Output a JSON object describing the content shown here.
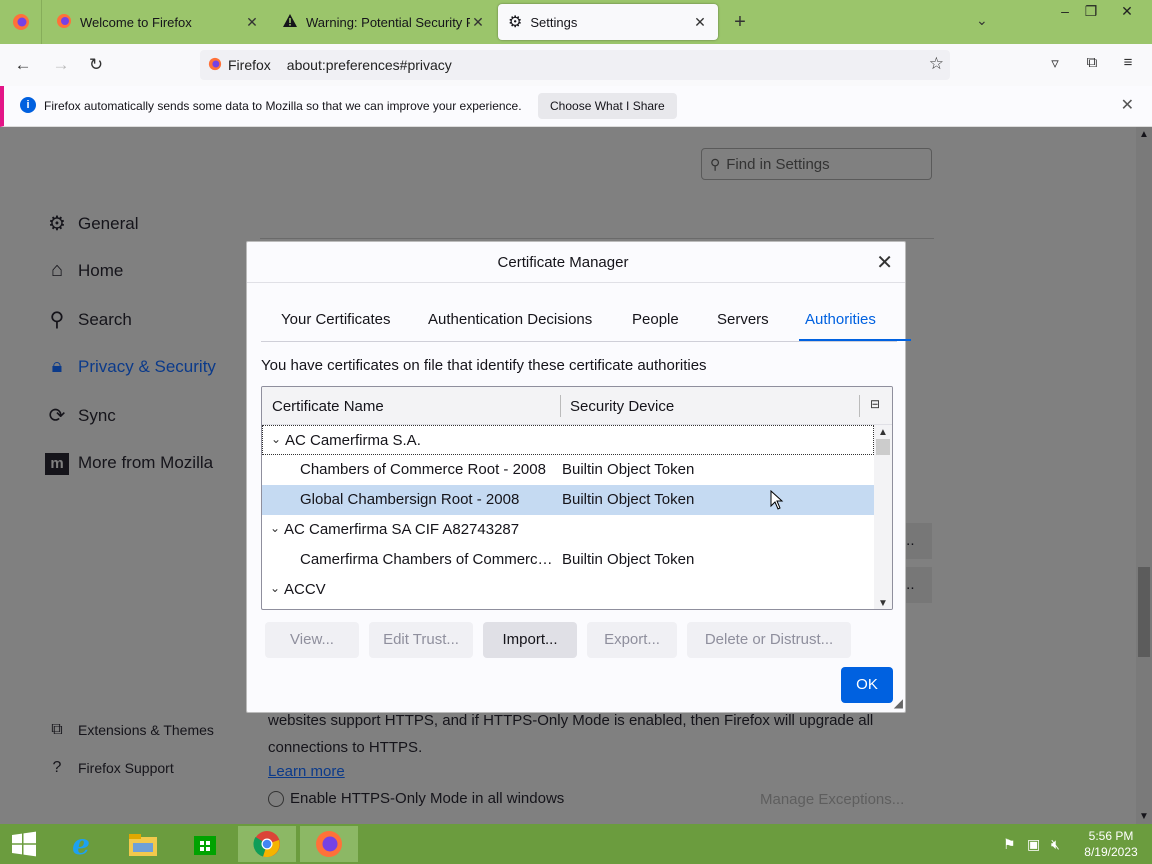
{
  "browser": {
    "tabs": [
      {
        "label": "Welcome to Firefox",
        "icon": "firefox-icon"
      },
      {
        "label": "Warning: Potential Security Risk",
        "icon": "warning-icon"
      },
      {
        "label": "Settings",
        "icon": "gear-icon",
        "active": true
      }
    ],
    "identity_label": "Firefox",
    "url": "about:preferences#privacy"
  },
  "notification": {
    "message": "Firefox automatically sends some data to Mozilla so that we can improve your experience.",
    "button": "Choose What I Share"
  },
  "settings": {
    "find_placeholder": "Find in Settings",
    "categories": [
      {
        "label": "General",
        "icon": "gear-icon"
      },
      {
        "label": "Home",
        "icon": "home-icon"
      },
      {
        "label": "Search",
        "icon": "search-icon"
      },
      {
        "label": "Privacy & Security",
        "icon": "lock-icon",
        "selected": true
      },
      {
        "label": "Sync",
        "icon": "sync-icon"
      },
      {
        "label": "More from Mozilla",
        "icon": "mozilla-icon"
      }
    ],
    "footer_links": [
      {
        "label": "Extensions & Themes",
        "icon": "puzzle-icon"
      },
      {
        "label": "Firefox Support",
        "icon": "help-icon"
      }
    ],
    "https_text_line1": "websites support HTTPS, and if HTTPS-Only Mode is enabled, then Firefox will upgrade all",
    "https_text_line2": "connections to HTTPS.",
    "learn_more": "Learn more",
    "radio_label": "Enable HTTPS-Only Mode in all windows",
    "manage_exceptions": "Manage Exceptions...",
    "ghost_ellipsis": "..."
  },
  "dialog": {
    "title": "Certificate Manager",
    "tabs": [
      "Your Certificates",
      "Authentication Decisions",
      "People",
      "Servers",
      "Authorities"
    ],
    "active_tab": "Authorities",
    "description": "You have certificates on file that identify these certificate authorities",
    "columns": [
      "Certificate Name",
      "Security Device"
    ],
    "rows": [
      {
        "name": "AC Camerfirma S.A.",
        "device": "",
        "group": true
      },
      {
        "name": "Chambers of Commerce Root - 2008",
        "device": "Builtin Object Token",
        "group": false
      },
      {
        "name": "Global Chambersign Root - 2008",
        "device": "Builtin Object Token",
        "group": false,
        "selected": true
      },
      {
        "name": "AC Camerfirma SA CIF A82743287",
        "device": "",
        "group": true
      },
      {
        "name": "Camerfirma Chambers of Commerce ...",
        "device": "Builtin Object Token",
        "group": false
      },
      {
        "name": "ACCV",
        "device": "",
        "group": true
      }
    ],
    "buttons": {
      "view": "View...",
      "edit_trust": "Edit Trust...",
      "import": "Import...",
      "export": "Export...",
      "delete": "Delete or Distrust...",
      "ok": "OK"
    }
  },
  "taskbar": {
    "time": "5:56 PM",
    "date": "8/19/2023"
  },
  "colors": {
    "accent": "#0061e0",
    "tabstrip": "#9bc56b",
    "taskbar": "#6b9c3e",
    "selected_row": "#c5daf2"
  }
}
